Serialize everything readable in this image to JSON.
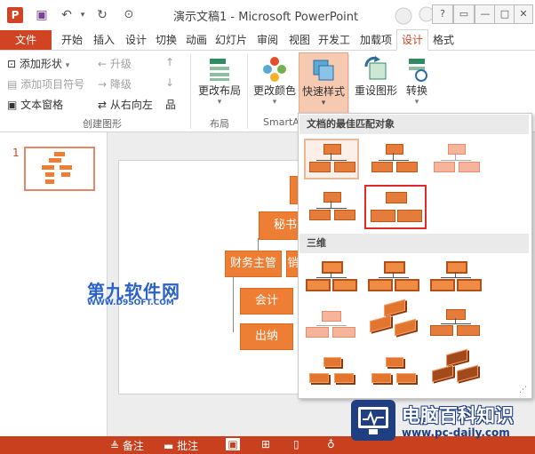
{
  "window": {
    "title": "演示文稿1 - Microsoft PowerPoint",
    "help": "?",
    "minimize": "—",
    "restore": "□",
    "close": "✕"
  },
  "qat": {
    "app_icon": "P",
    "save": "▣",
    "undo": "↶",
    "redo": "↻",
    "customize": "▾"
  },
  "tabs": [
    "文件",
    "开始",
    "插入",
    "设计",
    "切换",
    "动画",
    "幻灯片",
    "审阅",
    "视图",
    "开发工",
    "加载项",
    "设计",
    "格式"
  ],
  "ribbon": {
    "create_group": {
      "add_shape": "添加形状",
      "add_bullet": "添加项目符号",
      "text_pane": "文本窗格",
      "promote": "升级",
      "demote": "降级",
      "rtl": "从右向左",
      "label": "创建图形"
    },
    "layout_group": {
      "change_layout": "更改布局",
      "label": "布局"
    },
    "styles_group": {
      "change_colors": "更改颜色",
      "quick_styles": "快速样式",
      "label": "SmartA"
    },
    "reset_group": {
      "reset_graphic": "重设图形",
      "convert": "转换"
    }
  },
  "slides": {
    "number": "1"
  },
  "diagram": {
    "top": "秘书",
    "finance": "财务主管",
    "sales": "销",
    "accounting": "会计",
    "cashier": "出纳"
  },
  "gallery": {
    "header_best": "文档的最佳匹配对象",
    "header_3d": "三维"
  },
  "statusbar": {
    "notes": "备注",
    "comments": "批注"
  },
  "watermarks": {
    "left_cn": "第九软件网",
    "left_url": "WWW.D9SOFT.COM",
    "right_cn": "电脑百科知识",
    "right_url": "www.pc-daily.com"
  },
  "colors": {
    "accent": "#d04423",
    "shape": "#ee7e34",
    "selection": "#e0292b"
  }
}
